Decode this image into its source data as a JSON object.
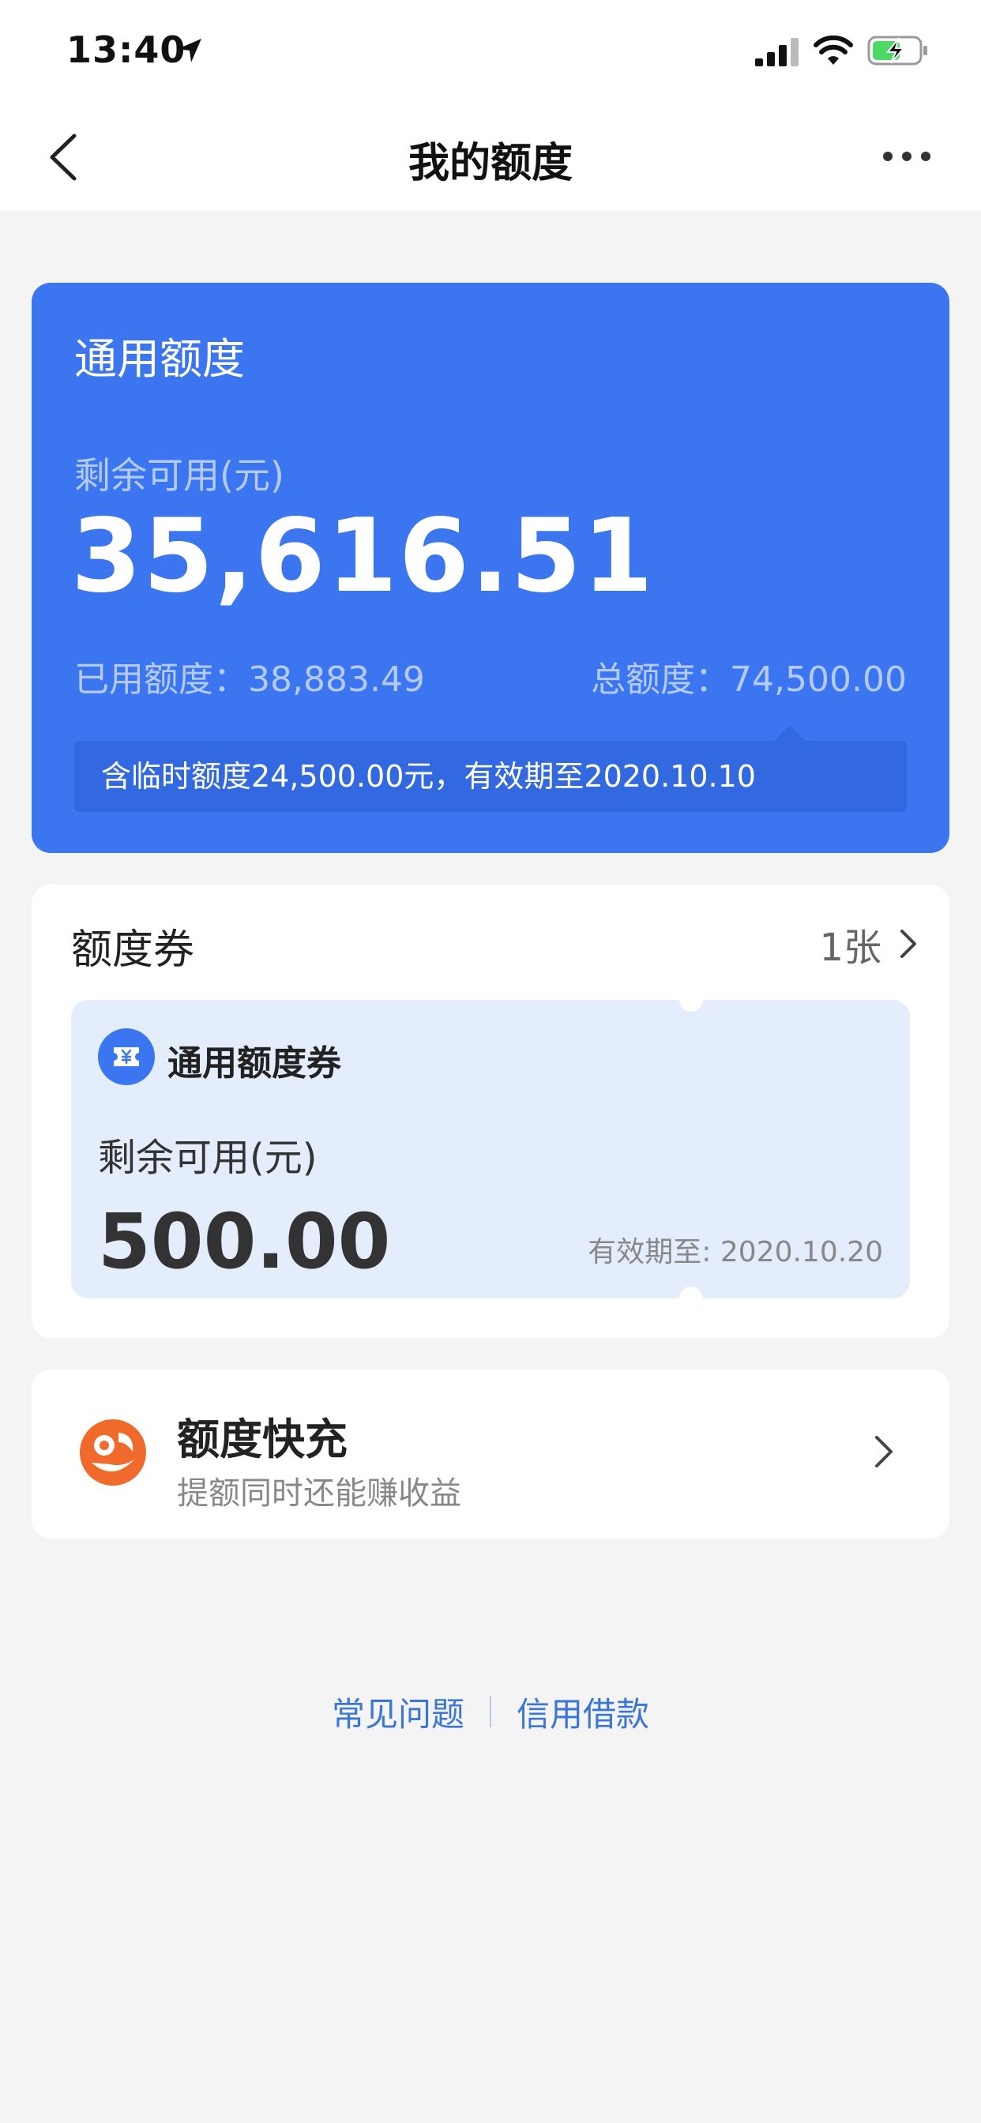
{
  "status_bar": {
    "time": "13:40"
  },
  "nav": {
    "title": "我的额度"
  },
  "credit_card": {
    "title": "通用额度",
    "remaining_label": "剩余可用(元)",
    "remaining_amount": "35,616.51",
    "used_text": "已用额度：38,883.49",
    "total_text": "总额度：74,500.00",
    "temp_notice": "含临时额度24,500.00元，有效期至2020.10.10"
  },
  "coupon_section": {
    "title": "额度券",
    "count": "1张",
    "coupon": {
      "name": "通用额度券",
      "remaining_label": "剩余可用(元)",
      "amount": "500.00",
      "expiry": "有效期至: 2020.10.20"
    }
  },
  "topup": {
    "title": "额度快充",
    "subtitle": "提额同时还能赚收益"
  },
  "footer": {
    "link_faq": "常见问题",
    "link_credit_loan": "信用借款"
  },
  "colors": {
    "card_blue": "#3b76f0",
    "coupon_bg": "#e3edfb",
    "link_blue": "#3b76d6",
    "accent_orange": "#f06a2b"
  }
}
